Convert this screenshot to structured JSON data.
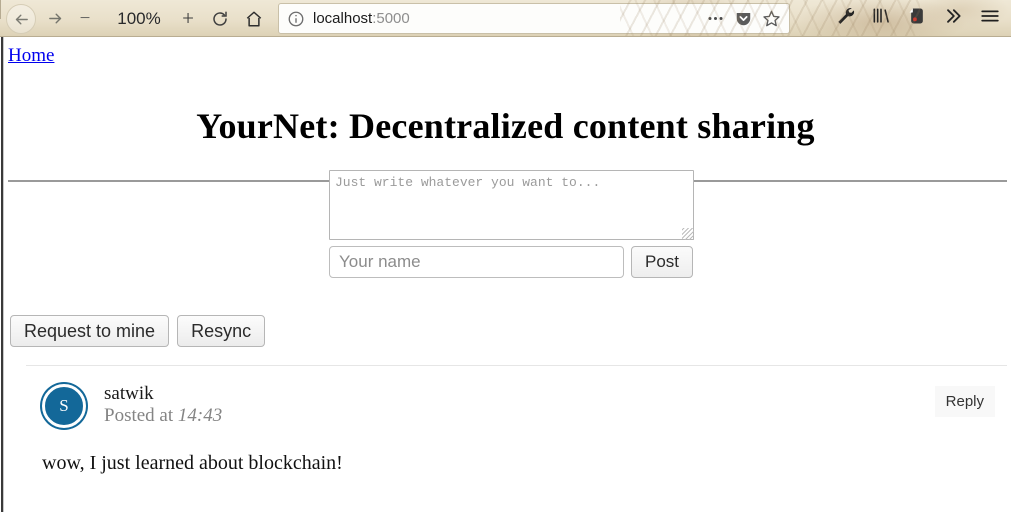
{
  "browser": {
    "back_icon": "back-arrow-icon",
    "forward_icon": "forward-arrow-icon",
    "zoom_out_label": "−",
    "zoom_level": "100%",
    "zoom_in_label": "+",
    "reload_icon": "reload-icon",
    "home_icon": "home-icon",
    "url_host": "localhost",
    "url_port": ":5000",
    "identity_icon": "info-circle-icon",
    "page_actions_icon": "ellipsis-icon",
    "pocket_icon": "pocket-icon",
    "bookmark_icon": "star-icon",
    "extensions": [
      {
        "name": "wrench-icon"
      },
      {
        "name": "library-icon"
      },
      {
        "name": "evernote-icon"
      },
      {
        "name": "overflow-chevrons-icon"
      },
      {
        "name": "hamburger-menu-icon"
      }
    ]
  },
  "page": {
    "home_link": "Home",
    "title": "YourNet: Decentralized content sharing",
    "compose": {
      "text_placeholder": "Just write whatever you want to...",
      "text_value": "",
      "name_placeholder": "Your name",
      "name_value": "",
      "post_label": "Post"
    },
    "actions": [
      {
        "label": "Request to mine"
      },
      {
        "label": "Resync"
      }
    ],
    "posts": [
      {
        "avatar_initial": "S",
        "author": "satwik",
        "posted_prefix": "Posted at ",
        "posted_time": "14:43",
        "reply_label": "Reply",
        "body": "wow, I just learned about blockchain!"
      }
    ]
  },
  "colors": {
    "link": "#0000ee",
    "avatar": "#136899",
    "rule": "#9a9a9a"
  }
}
